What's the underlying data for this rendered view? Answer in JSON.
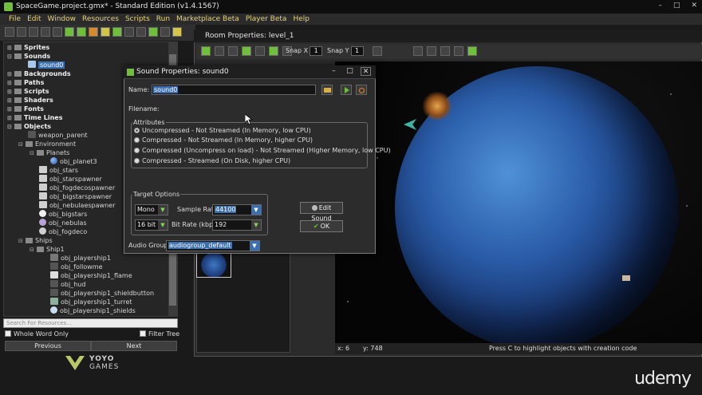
{
  "app": {
    "title": "SpaceGame.project.gmx* - Standard Edition (v1.4.1567)",
    "window_controls": [
      "–",
      "□",
      "✕"
    ]
  },
  "menu": [
    "File",
    "Edit",
    "Window",
    "Resources",
    "Scripts",
    "Run",
    "Marketplace Beta",
    "Player Beta",
    "Help"
  ],
  "tree": {
    "sprites": "Sprites",
    "sounds": "Sounds",
    "sound0": "sound0",
    "backgrounds": "Backgrounds",
    "paths": "Paths",
    "scripts": "Scripts",
    "shaders": "Shaders",
    "fonts": "Fonts",
    "timelines": "Time Lines",
    "objects": "Objects",
    "weapon_parent": "weapon_parent",
    "environment": "Environment",
    "planets": "Planets",
    "obj_planet3": "obj_planet3",
    "obj_stars": "obj_stars",
    "obj_starspawner": "obj_starspawner",
    "obj_fogdecospawner": "obj_fogdecospawner",
    "obj_bigstarspawner": "obj_bigstarspawner",
    "obj_nebulaespawner": "obj_nebulaespawner",
    "obj_bigstars": "obj_bigstars",
    "obj_nebulas": "obj_nebulas",
    "obj_fogdeco": "obj_fogdeco",
    "ships": "Ships",
    "ship1": "Ship1",
    "obj_playership1": "obj_playership1",
    "obj_followme": "obj_followme",
    "obj_playership1_flame": "obj_playership1_flame",
    "obj_hud": "obj_hud",
    "obj_playership1_shieldbutton": "obj_playership1_shieldbutton",
    "obj_playership1_turret": "obj_playership1_turret",
    "obj_playership1_shields": "obj_playership1_shields"
  },
  "search": {
    "placeholder": "Search For Resources...",
    "whole_word": "Whole Word Only",
    "filter_tree": "Filter Tree",
    "previous": "Previous",
    "next": "Next"
  },
  "logo": {
    "line1": "YOYO",
    "line2": "GAMES"
  },
  "room": {
    "title": "Room Properties: level_1",
    "snap_x_label": "Snap X",
    "snap_x": "1",
    "snap_y_label": "Snap Y",
    "snap_y": "1",
    "status_x": "x: 6",
    "status_y": "y: 748",
    "status_hint": "Press C to highlight objects with creation code"
  },
  "dialog": {
    "title": "Sound Properties: sound0",
    "name_label": "Name:",
    "name_value": "sound0",
    "filename_label": "Filename:",
    "attributes_label": "Attributes",
    "attributes": [
      "Uncompressed - Not Streamed (In Memory, low CPU)",
      "Compressed - Not Streamed (In Memory, higher CPU)",
      "Compressed (Uncompress on load) - Not Streamed (Higher Memory, low CPU)",
      "Compressed - Streamed (On Disk, higher CPU)"
    ],
    "selected_attribute": 0,
    "target_options_label": "Target Options",
    "channels": "Mono",
    "sample_rate_label": "Sample Rate",
    "sample_rate": "44100",
    "bits": "16 bit",
    "bit_rate_label": "Bit Rate (kbps)",
    "bit_rate": "192",
    "edit_sound": "Edit Sound",
    "ok": "OK",
    "audio_group_label": "Audio Group:",
    "audio_group": "audiogroup_default"
  },
  "brand": "udemy",
  "colors": {
    "accent": "#e8d27a",
    "selection": "#3b6fb0",
    "play_green": "#6fbf3a",
    "planet_blue": "#2a5ca8"
  }
}
